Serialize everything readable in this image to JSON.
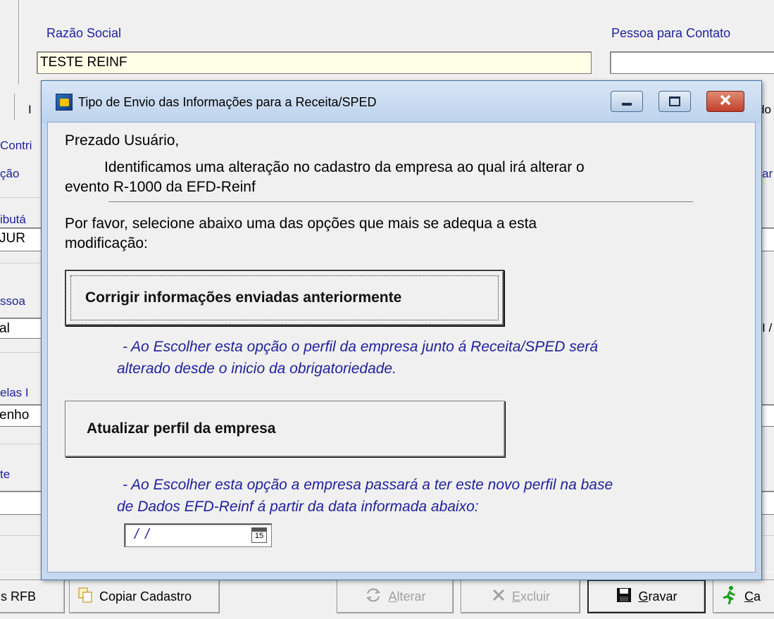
{
  "background_form": {
    "razao_label": "Razão Social",
    "razao_value": "TESTE REINF",
    "contato_label": "Pessoa para Contato",
    "contato_value": "",
    "fragments": [
      "I",
      "do",
      "Contri",
      "ção",
      "ar",
      "ibutá",
      "JUR",
      "ssoa",
      "al",
      "I /",
      "elas I",
      "enho",
      "te"
    ],
    "toolbar": {
      "rfb": "s RFB",
      "copiar": "Copiar Cadastro",
      "alterar": "Alterar",
      "excluir": "Excluir",
      "gravar": "Gravar",
      "cancelar": "Ca"
    }
  },
  "dialog": {
    "title": "Tipo de Envio das Informações para a Receita/SPED",
    "greeting": "Prezado Usuário,",
    "message_line1": "Identificamos uma alteração no cadastro da empresa ao qual irá alterar o",
    "message_line2": "evento R-1000 da EFD-Reinf",
    "prompt_line1": "Por favor, selecione abaixo uma das opções que mais se adequa a esta",
    "prompt_line2": "modificação:",
    "option1": {
      "label": "Corrigir informações enviadas anteriormente",
      "note_line1": "- Ao Escolher esta opção o perfil da empresa junto á Receita/SPED será",
      "note_line2": "alterado desde o inicio da obrigatoriedade."
    },
    "option2": {
      "label": "Atualizar perfil da empresa",
      "note_line1": "- Ao Escolher esta opção a empresa passará a ter este novo perfil na base",
      "note_line2": "de Dados EFD-Reinf á partir da data informada abaixo:"
    },
    "date_value": "/ /",
    "calendar_day": "15"
  },
  "colors": {
    "label_blue": "#1f1f9c",
    "dialog_frame": "#c7d9ef",
    "close_button": "#c1402b"
  }
}
